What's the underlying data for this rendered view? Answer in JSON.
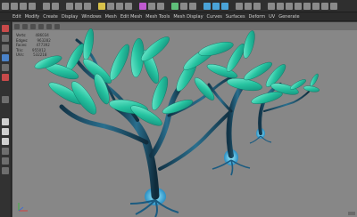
{
  "menubar": {
    "items": [
      "Edit",
      "Modify",
      "Create",
      "Display",
      "Windows",
      "Mesh",
      "Edit Mesh",
      "Mesh Tools",
      "Mesh Display",
      "Curves",
      "Surfaces",
      "Deform",
      "UV",
      "Generate"
    ]
  },
  "hud": {
    "rows": [
      {
        "label": "Verts:",
        "value": "486034"
      },
      {
        "label": "Edges:",
        "value": "963282"
      },
      {
        "label": "Faces:",
        "value": "477392"
      },
      {
        "label": "Tris:",
        "value": "955012"
      },
      {
        "label": "UVs:",
        "value": "532218"
      }
    ]
  },
  "colors": {
    "viewport_bg": "#878787",
    "leaf": "#2fcfa8",
    "trunk": "#1d4f6a",
    "root_glow": "#5fd6ff"
  },
  "icons": {
    "toolbar": [
      "select-tool-icon",
      "move-tool-icon",
      "rotate-tool-icon",
      "scale-tool-icon",
      "snap-icon",
      "render-icon"
    ],
    "toolbox": [
      "select-icon",
      "lasso-icon",
      "paint-icon",
      "move-icon",
      "rotate-icon",
      "scale-icon",
      "layout-icon"
    ]
  }
}
